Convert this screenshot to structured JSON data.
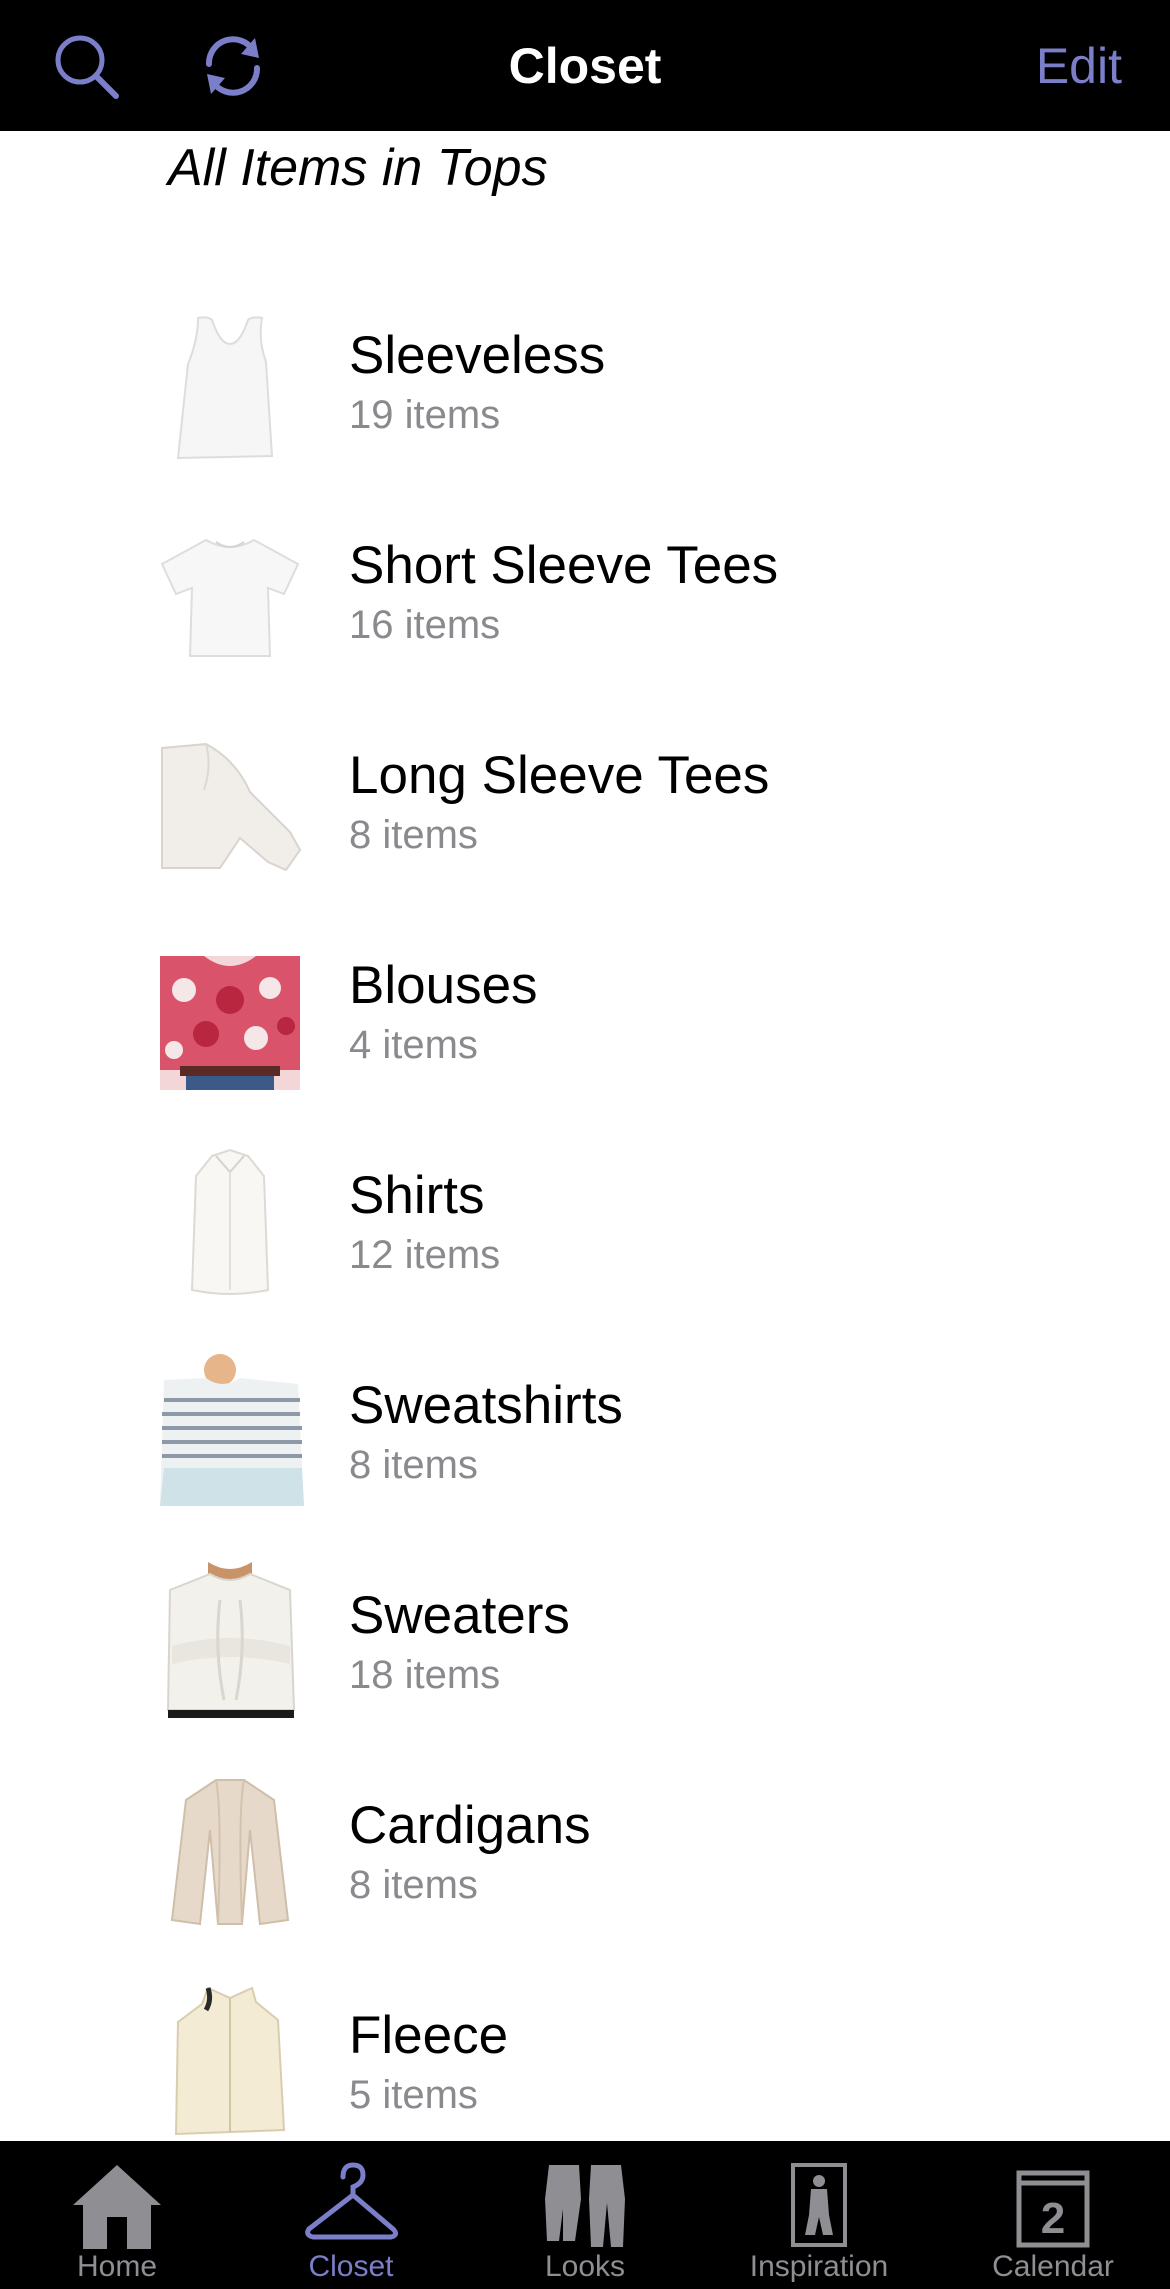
{
  "header": {
    "title": "Closet",
    "edit_label": "Edit",
    "search_icon": "search-icon",
    "sync_icon": "sync-icon"
  },
  "section": {
    "heading": "All Items in Tops"
  },
  "categories": [
    {
      "name": "Sleeveless",
      "count": "19 items",
      "thumb": "tank-top"
    },
    {
      "name": "Short Sleeve Tees",
      "count": "16 items",
      "thumb": "tshirt"
    },
    {
      "name": "Long Sleeve Tees",
      "count": "8 items",
      "thumb": "long-sleeve"
    },
    {
      "name": "Blouses",
      "count": "4 items",
      "thumb": "floral-blouse"
    },
    {
      "name": "Shirts",
      "count": "12 items",
      "thumb": "white-shirt"
    },
    {
      "name": "Sweatshirts",
      "count": "8 items",
      "thumb": "striped-sweatshirt"
    },
    {
      "name": "Sweaters",
      "count": "18 items",
      "thumb": "cable-sweater"
    },
    {
      "name": "Cardigans",
      "count": "8 items",
      "thumb": "cardigan"
    },
    {
      "name": "Fleece",
      "count": "5 items",
      "thumb": "fleece"
    }
  ],
  "tabs": [
    {
      "label": "Home",
      "icon": "home-icon",
      "active": false
    },
    {
      "label": "Closet",
      "icon": "hanger-icon",
      "active": true
    },
    {
      "label": "Looks",
      "icon": "looks-icon",
      "active": false
    },
    {
      "label": "Inspiration",
      "icon": "inspiration-icon",
      "active": false
    },
    {
      "label": "Calendar",
      "icon": "calendar-icon",
      "active": false,
      "badge": "2"
    }
  ],
  "colors": {
    "accent": "#7b7ec9",
    "bar_background": "#000000",
    "inactive_tab": "#8e8e93",
    "secondary_text": "#8a8a8e"
  }
}
